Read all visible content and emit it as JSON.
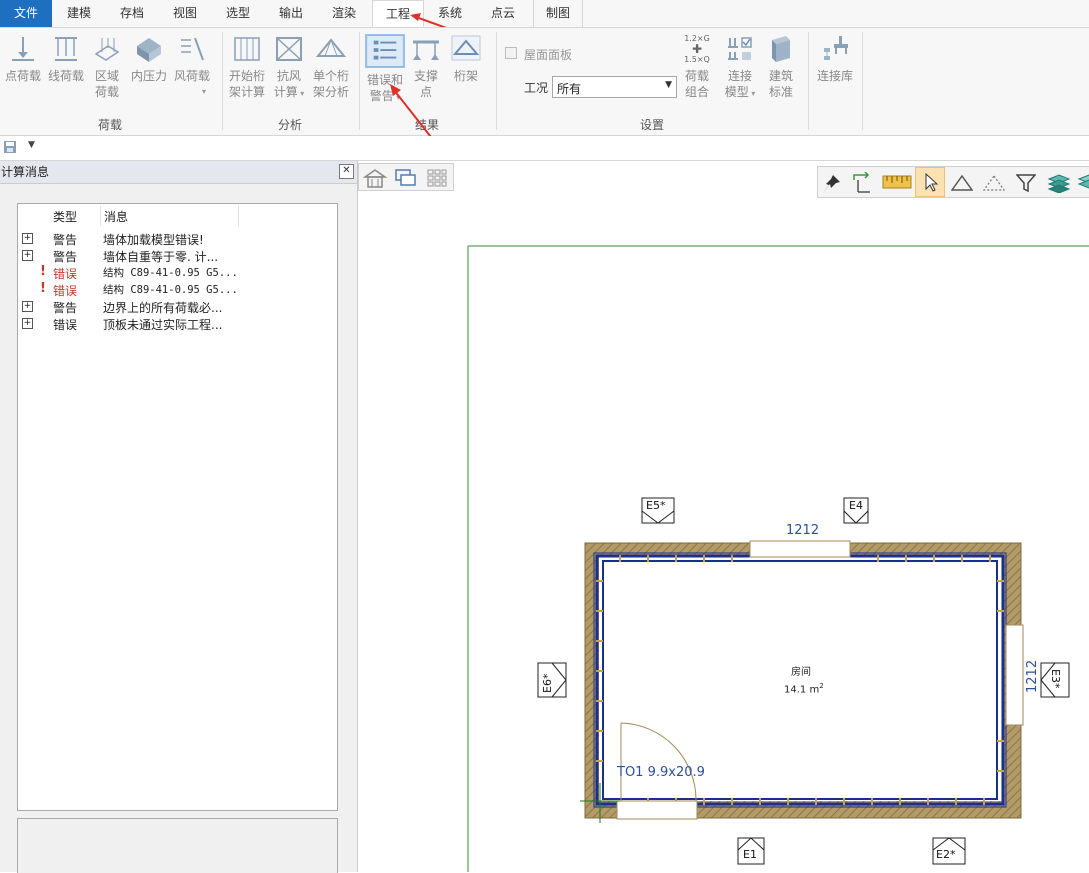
{
  "tabs": [
    {
      "label": "文件"
    },
    {
      "label": "建模"
    },
    {
      "label": "存档"
    },
    {
      "label": "视图"
    },
    {
      "label": "选型"
    },
    {
      "label": "输出"
    },
    {
      "label": "渲染"
    },
    {
      "label": "工程"
    },
    {
      "label": "系统"
    },
    {
      "label": "点云"
    },
    {
      "label": "制图"
    }
  ],
  "ribbon": {
    "loads": {
      "title": "荷载",
      "buttons": [
        {
          "label": "点荷载"
        },
        {
          "label": "线荷载"
        },
        {
          "label": "区域",
          "label2": "荷载"
        },
        {
          "label": "内压力"
        },
        {
          "label": "风荷载"
        }
      ]
    },
    "analysis": {
      "title": "分析",
      "buttons": [
        {
          "label": "开始桁",
          "label2": "架计算"
        },
        {
          "label": "抗风",
          "label2": "计算"
        },
        {
          "label": "单个桁",
          "label2": "架分析"
        }
      ]
    },
    "results": {
      "title": "结果",
      "buttons": [
        {
          "label": "错误和",
          "label2": "警告"
        },
        {
          "label": "支撑",
          "label2": "点"
        },
        {
          "label": "桁架"
        }
      ]
    },
    "settings": {
      "title": "设置",
      "roof_panel_label": "屋面面板",
      "workcase_label": "工况",
      "workcase_value": "所有",
      "load_combo_formula_top": "1.2×G",
      "load_combo_formula_bottom": "1.5×Q",
      "buttons": [
        {
          "label": "荷载",
          "label2": "组合"
        },
        {
          "label": "连接",
          "label2": "模型"
        },
        {
          "label": "建筑",
          "label2": "标准"
        }
      ]
    },
    "library": {
      "buttons": [
        {
          "label": "连接库"
        }
      ]
    }
  },
  "panel": {
    "title": "计算消息",
    "close_glyph": "✕",
    "columns": {
      "type": "类型",
      "message": "消息"
    },
    "rows": [
      {
        "expander": "+",
        "type": "警告",
        "message": "墙体加载模型错误!",
        "kind": "warning"
      },
      {
        "expander": "+",
        "type": "警告",
        "message": "墙体自重等于零. 计...",
        "kind": "warning"
      },
      {
        "icon": "!",
        "type": "错误",
        "message": "结构 C89-41-0.95 G5...",
        "kind": "error"
      },
      {
        "icon": "!",
        "type": "错误",
        "message": "结构 C89-41-0.95 G5...",
        "kind": "error"
      },
      {
        "expander": "+",
        "type": "警告",
        "message": "边界上的所有荷载必...",
        "kind": "warning"
      },
      {
        "expander": "+",
        "type": "错误",
        "message": "顶板未通过实际工程...",
        "kind": "error-plain"
      }
    ]
  },
  "drawing": {
    "room_name": "房间",
    "room_area": "14.1 m",
    "room_area_sup": "2",
    "dim_top": "1212",
    "dim_right": "1212",
    "door_label": "TO1 9.9x20.9",
    "elevations": {
      "e1": "E1",
      "e2": "E2*",
      "e3": "E3*",
      "e4": "E4",
      "e5": "E5*",
      "e6": "E6*"
    }
  },
  "colors": {
    "tab_file_bg": "#1f6fc1",
    "wall_hatch": "#a08b5a",
    "frame_blue": "#1b2f8c",
    "annotation_red": "#e0302a"
  }
}
